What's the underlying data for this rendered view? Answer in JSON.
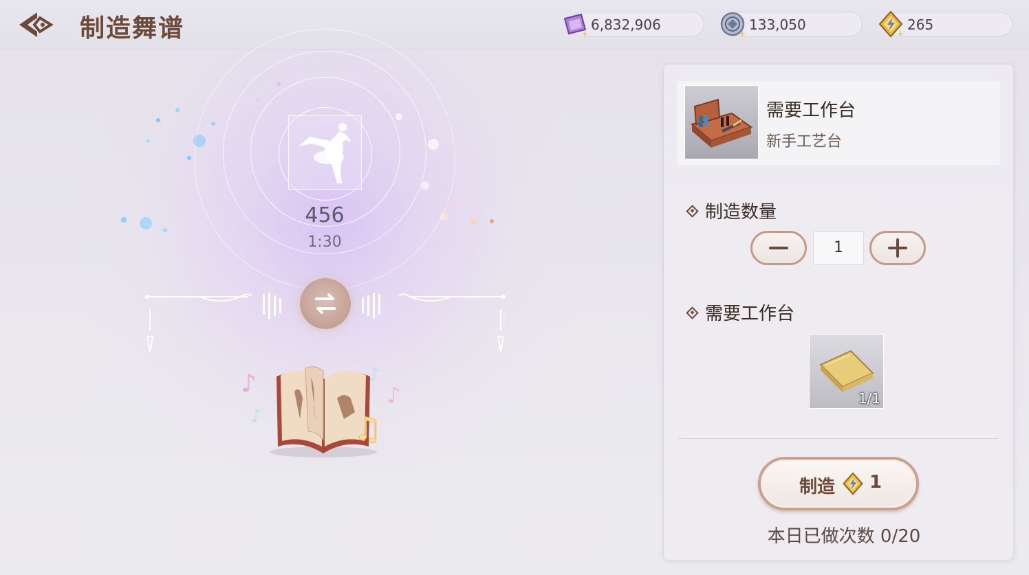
{
  "header": {
    "title": "制造舞谱",
    "currencies": [
      {
        "icon": "purple-ticket-icon",
        "value": "6,832,906"
      },
      {
        "icon": "silver-coin-icon",
        "value": "133,050"
      },
      {
        "icon": "energy-gem-icon",
        "value": "265"
      }
    ]
  },
  "score": {
    "icon": "ballerina-icon",
    "number": "456",
    "time": "1:30"
  },
  "panel": {
    "workbench": {
      "title": "需要工作台",
      "name": "新手工艺台",
      "icon": "crafting-table-icon"
    },
    "quantity": {
      "label": "制造数量",
      "value": "1",
      "minus_icon": "minus-icon",
      "plus_icon": "plus-icon"
    },
    "materials": {
      "label": "需要工作台",
      "items": [
        {
          "icon": "golden-book-icon",
          "count": "1/1"
        }
      ]
    },
    "craft": {
      "label": "制造",
      "cost_icon": "energy-gem-icon",
      "cost": "1"
    },
    "daily": "本日已做次数 0/20"
  },
  "colors": {
    "accent_brown": "#6b4a3a",
    "button_border": "#c59a86",
    "background": "#e9e7ed"
  }
}
